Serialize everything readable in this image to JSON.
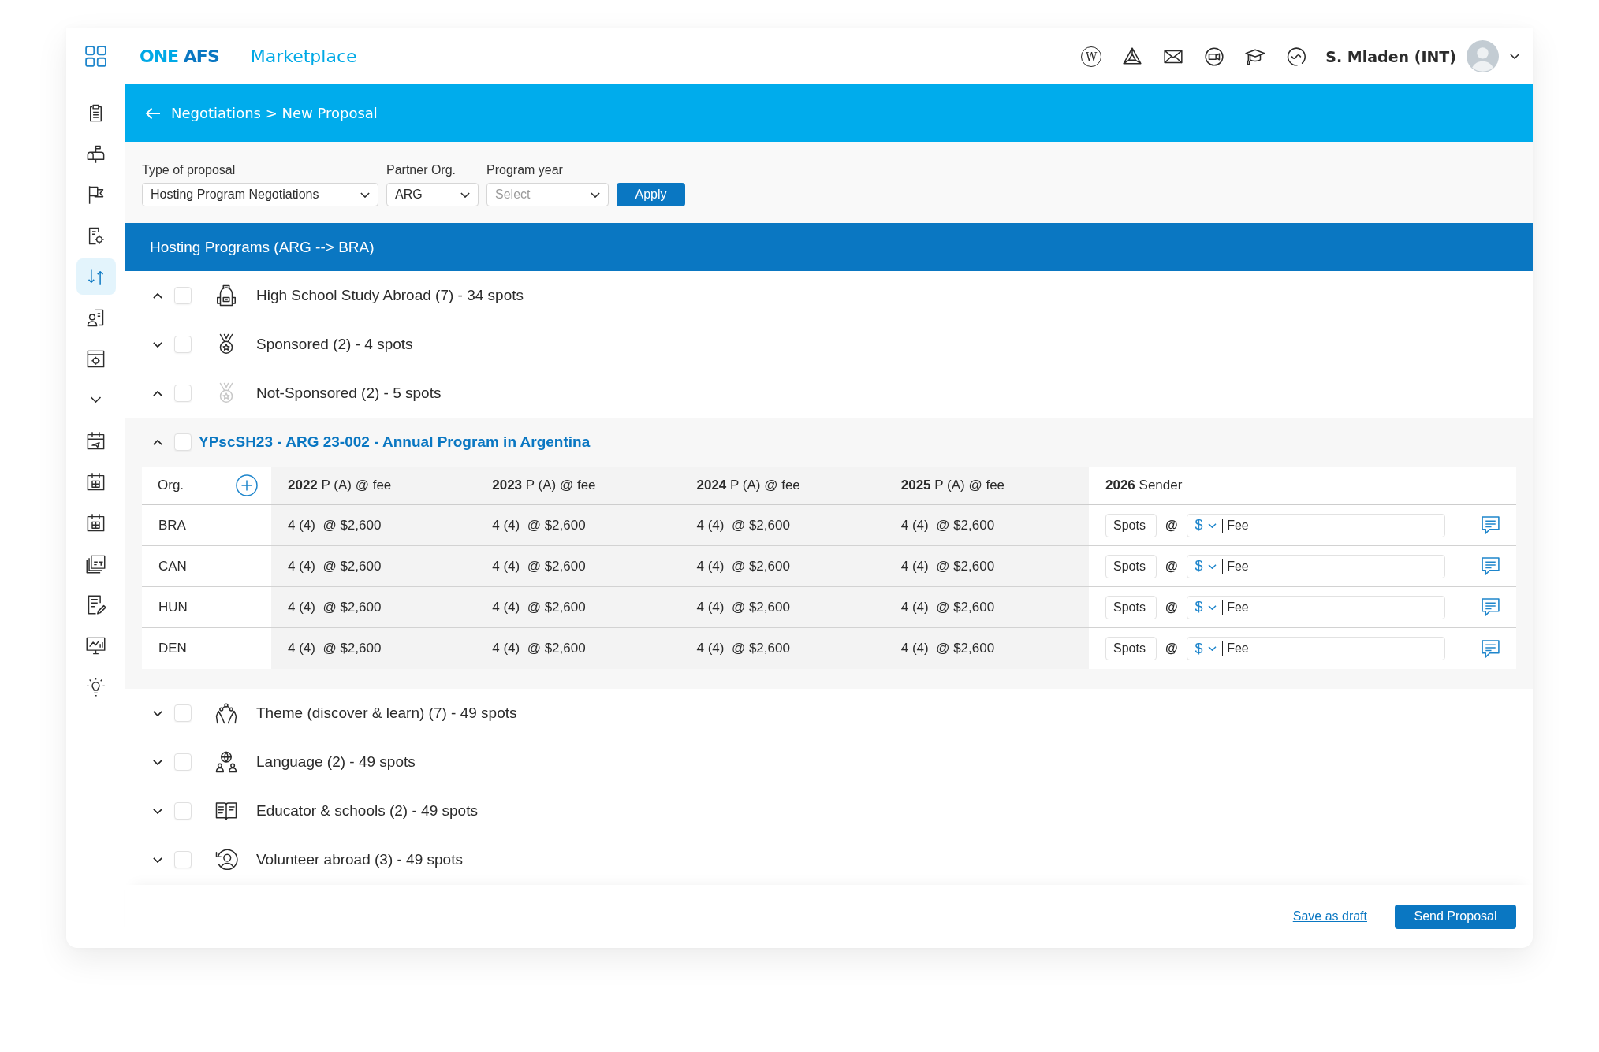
{
  "header": {
    "logo": {
      "first": "ONE",
      "second": "AFS"
    },
    "app_name": "Marketplace",
    "wiki_letter": "W",
    "user_name": "S. Mladen (INT)"
  },
  "sidebar": {
    "items": [
      {
        "selected": false
      },
      {
        "selected": false
      },
      {
        "selected": false
      },
      {
        "selected": false
      },
      {
        "selected": true
      },
      {
        "selected": false
      },
      {
        "selected": false
      }
    ],
    "more_items": [
      {
        "selected": false
      },
      {
        "selected": false
      },
      {
        "selected": false
      },
      {
        "selected": false
      },
      {
        "selected": false
      },
      {
        "selected": false
      },
      {
        "selected": false
      }
    ]
  },
  "page_title": "Negotiations > New Proposal",
  "filters": [
    {
      "label": "Type of proposal",
      "value": "Hosting Program Negotiations"
    },
    {
      "label": "Partner Org.",
      "value": "ARG"
    },
    {
      "label": "Program year",
      "placeholder": "Select"
    }
  ],
  "apply_button": "Apply",
  "section_title": "Hosting Programs (ARG --> BRA)",
  "items": [
    {
      "kind": "category",
      "label": "High School Study Abroad (7) - 34 spots",
      "expanded": true,
      "checked": false,
      "icon_muted": false
    },
    {
      "kind": "category",
      "label": "Sponsored (2) - 4 spots",
      "expanded": false,
      "checked": false,
      "icon_muted": false
    },
    {
      "kind": "category",
      "label": "Not-Sponsored (2) - 5 spots",
      "expanded": true,
      "checked": false,
      "icon_muted": true
    },
    {
      "kind": "program",
      "label": "YPscSH23 - ARG 23-002 - Annual Program in Argentina",
      "expanded": true,
      "checked": false,
      "table": {
        "org_header": "Org.",
        "columns": [
          "**2022** P (A) @ fee",
          "**2023** P (A) @ fee",
          "**2024** P (A) @ fee",
          "**2025** P (A) @ fee"
        ],
        "sender_header": "**2026** Sender",
        "rows": [
          {
            "org": "BRA",
            "cells": [
              "4 (4)  @ $2,600",
              "4 (4)  @ $2,600",
              "4 (4)  @ $2,600",
              "4 (4)  @ $2,600"
            ],
            "spots_placeholder": "Spots",
            "at": "@",
            "currency": "$",
            "fee_placeholder": "Fee"
          },
          {
            "org": "CAN",
            "cells": [
              "4 (4)  @ $2,600",
              "4 (4)  @ $2,600",
              "4 (4)  @ $2,600",
              "4 (4)  @ $2,600"
            ],
            "spots_placeholder": "Spots",
            "at": "@",
            "currency": "$",
            "fee_placeholder": "Fee"
          },
          {
            "org": "HUN",
            "cells": [
              "4 (4)  @ $2,600",
              "4 (4)  @ $2,600",
              "4 (4)  @ $2,600",
              "4 (4)  @ $2,600"
            ],
            "spots_placeholder": "Spots",
            "at": "@",
            "currency": "$",
            "fee_placeholder": "Fee"
          },
          {
            "org": "DEN",
            "cells": [
              "4 (4)  @ $2,600",
              "4 (4)  @ $2,600",
              "4 (4)  @ $2,600",
              "4 (4)  @ $2,600"
            ],
            "spots_placeholder": "Spots",
            "at": "@",
            "currency": "$",
            "fee_placeholder": "Fee"
          }
        ]
      }
    },
    {
      "kind": "category",
      "label": "Theme (discover & learn) (7) - 49 spots",
      "expanded": false,
      "checked": false,
      "icon_muted": false
    },
    {
      "kind": "category",
      "label": "Language (2) - 49 spots",
      "expanded": false,
      "checked": false,
      "icon_muted": false
    },
    {
      "kind": "category",
      "label": "Educator & schools (2) - 49 spots",
      "expanded": false,
      "checked": false,
      "icon_muted": false
    },
    {
      "kind": "category",
      "label": "Volunteer abroad (3) - 49 spots",
      "expanded": false,
      "checked": false,
      "icon_muted": false
    }
  ],
  "footer": {
    "save_draft": "Save as draft",
    "send_button": "Send Proposal"
  }
}
